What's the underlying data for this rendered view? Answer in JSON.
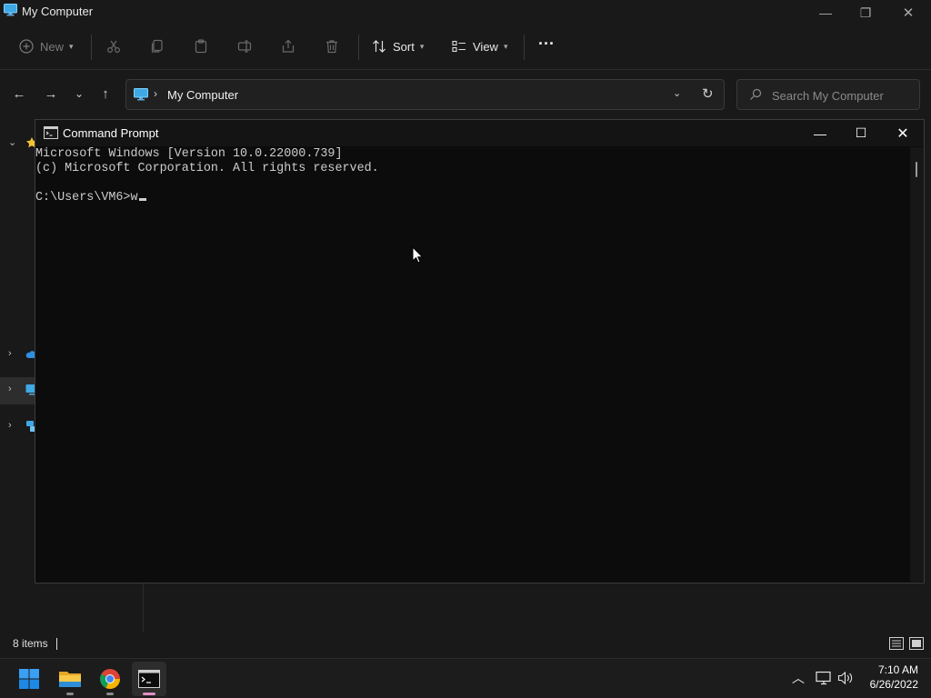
{
  "explorer": {
    "title": "My Computer",
    "window_controls": {
      "minimize": "—",
      "maximize": "❐",
      "close": "✕"
    },
    "toolbar": {
      "new_label": "New",
      "sort_label": "Sort",
      "view_label": "View",
      "more_label": "···",
      "disabled_actions": [
        "cut-icon",
        "copy-icon",
        "paste-icon",
        "rename-icon",
        "share-icon",
        "delete-icon"
      ]
    },
    "nav": {
      "back": "←",
      "forward": "→",
      "recent": "⌄",
      "up": "↑"
    },
    "address": {
      "location": "My Computer",
      "separator": "›"
    },
    "search": {
      "placeholder": "Search My Computer"
    },
    "sidebar": [
      "quick-access",
      "onedrive",
      "this-pc",
      "network"
    ],
    "status": {
      "item_count": "8 items"
    }
  },
  "cmd": {
    "title": "Command Prompt",
    "window_controls": {
      "minimize": "—",
      "maximize": "☐",
      "close": "✕"
    },
    "lines": [
      "Microsoft Windows [Version 10.0.22000.739]",
      "(c) Microsoft Corporation. All rights reserved.",
      "",
      "C:\\Users\\VM6>w"
    ]
  },
  "taskbar": {
    "apps": [
      "start-icon",
      "file-explorer-icon",
      "chrome-icon",
      "command-prompt-icon"
    ],
    "active_app": "command-prompt-icon",
    "time": "7:10 AM",
    "date": "6/26/2022"
  },
  "colors": {
    "explorer_bg": "#191919",
    "console_bg": "#0c0c0c",
    "console_text": "#cccccc",
    "accent": "#0078d4",
    "active_indicator": "#e08fc4"
  }
}
